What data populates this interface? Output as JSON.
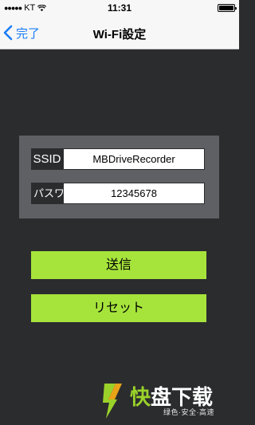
{
  "status_bar": {
    "carrier": "KT",
    "time": "11:31",
    "icons": [
      "signal-dots-icon",
      "wifi-icon",
      "battery-icon"
    ]
  },
  "nav": {
    "back_label": "完了",
    "title": "Wi-Fi設定"
  },
  "settings": {
    "ssid_label": "SSID",
    "ssid_value": "MBDriveRecorder",
    "password_label": "パスワード",
    "password_value": "12345678"
  },
  "buttons": {
    "send_label": "送信",
    "reset_label": "リセット"
  },
  "watermark": {
    "brand_part1": "快",
    "brand_part2": "盘下载",
    "tagline": "绿色·安全·高速"
  },
  "colors": {
    "background": "#2b2c2e",
    "panel": "#5e6064",
    "button_green": "#a6e43c",
    "ios_blue": "#1b7cf6"
  }
}
